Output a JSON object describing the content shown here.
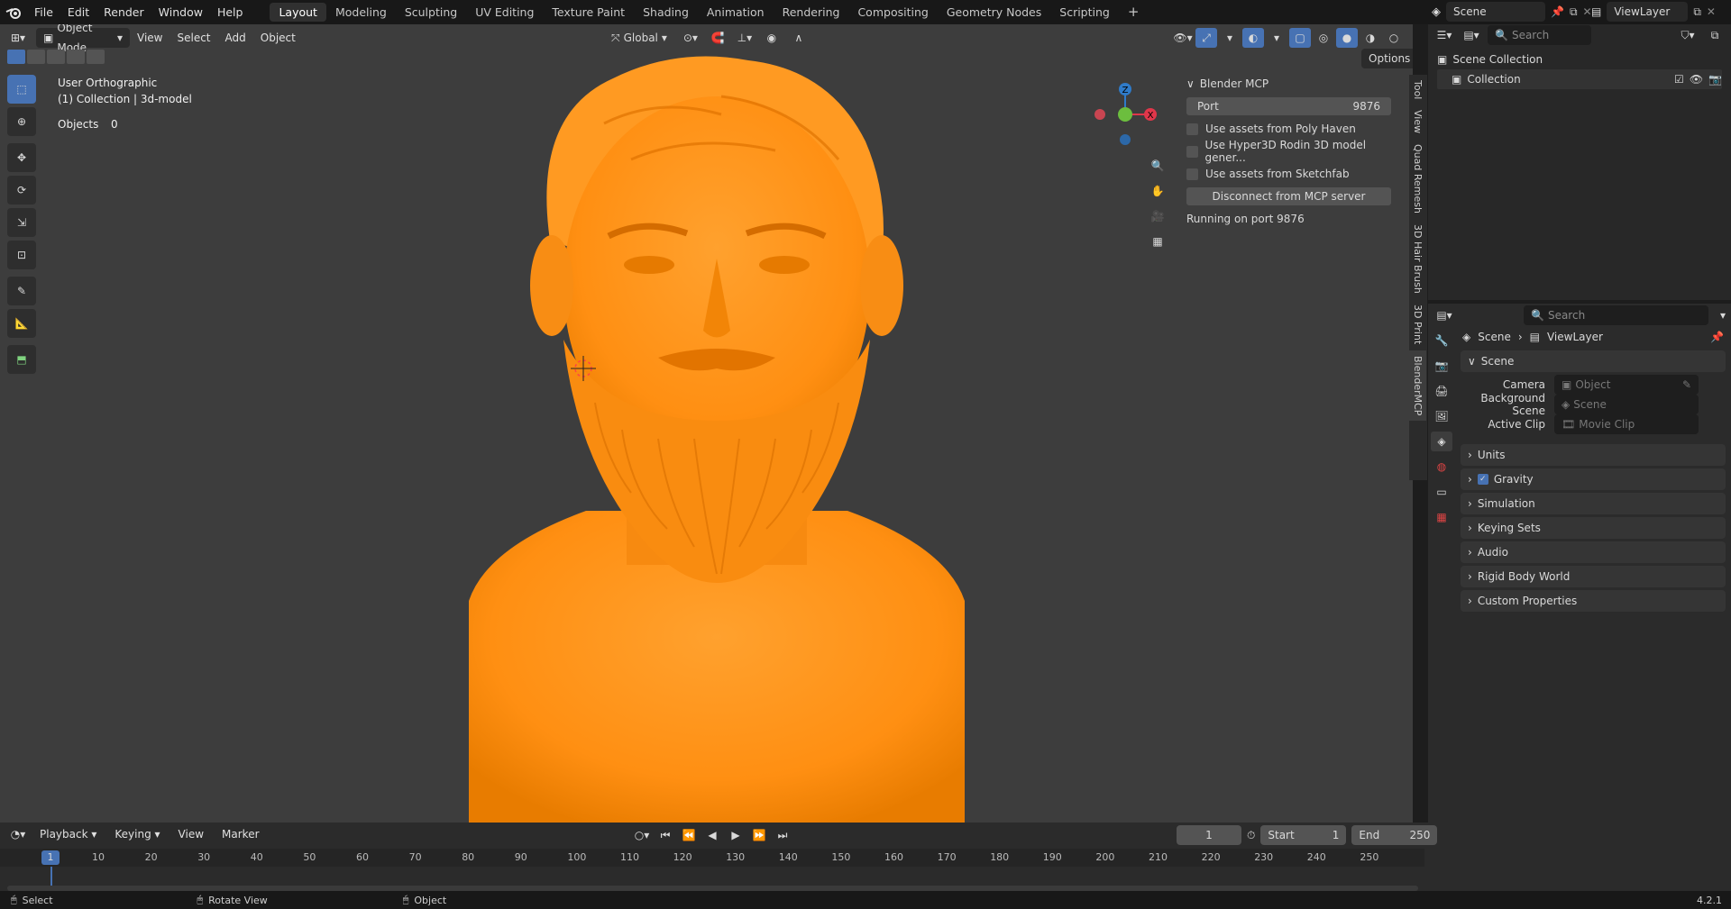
{
  "menus": [
    "File",
    "Edit",
    "Render",
    "Window",
    "Help"
  ],
  "workspaces": [
    "Layout",
    "Modeling",
    "Sculpting",
    "UV Editing",
    "Texture Paint",
    "Shading",
    "Animation",
    "Rendering",
    "Compositing",
    "Geometry Nodes",
    "Scripting"
  ],
  "active_workspace": "Layout",
  "scene_name": "Scene",
  "view_layer": "ViewLayer",
  "viewport": {
    "mode": "Object Mode",
    "menus": [
      "View",
      "Select",
      "Add",
      "Object"
    ],
    "transform": "Global",
    "options": "Options",
    "overlay_title": "User Orthographic",
    "overlay_sub": "(1) Collection | 3d-model",
    "objects_label": "Objects",
    "objects_count": "0"
  },
  "mcp": {
    "title": "Blender MCP",
    "port_label": "Port",
    "port_value": "9876",
    "options": [
      "Use assets from Poly Haven",
      "Use Hyper3D Rodin 3D model gener...",
      "Use assets from Sketchfab"
    ],
    "disconnect": "Disconnect from MCP server",
    "status": "Running on port 9876"
  },
  "side_tabs": [
    "Tool",
    "View",
    "Quad Remesh",
    "3D Hair Brush",
    "3D Print",
    "BlenderMCP"
  ],
  "outliner": {
    "search_placeholder": "Search",
    "scene_collection": "Scene Collection",
    "collection": "Collection"
  },
  "properties": {
    "search_placeholder": "Search",
    "breadcrumb_scene": "Scene",
    "breadcrumb_layer": "ViewLayer",
    "section_title": "Scene",
    "camera_label": "Camera",
    "camera_value": "Object",
    "bg_label": "Background Scene",
    "bg_value": "Scene",
    "clip_label": "Active Clip",
    "clip_value": "Movie Clip",
    "sections": [
      "Units",
      "Gravity",
      "Simulation",
      "Keying Sets",
      "Audio",
      "Rigid Body World",
      "Custom Properties"
    ]
  },
  "timeline": {
    "menus": [
      "Playback",
      "Keying",
      "View",
      "Marker"
    ],
    "current_frame": "1",
    "start_label": "Start",
    "start_value": "1",
    "end_label": "End",
    "end_value": "250",
    "ticks": [
      "10",
      "20",
      "30",
      "40",
      "50",
      "60",
      "70",
      "80",
      "90",
      "100",
      "110",
      "120",
      "130",
      "140",
      "150",
      "160",
      "170",
      "180",
      "190",
      "200",
      "210",
      "220",
      "230",
      "240",
      "250"
    ]
  },
  "status": {
    "select": "Select",
    "rotate": "Rotate View",
    "object": "Object",
    "version": "4.2.1"
  }
}
